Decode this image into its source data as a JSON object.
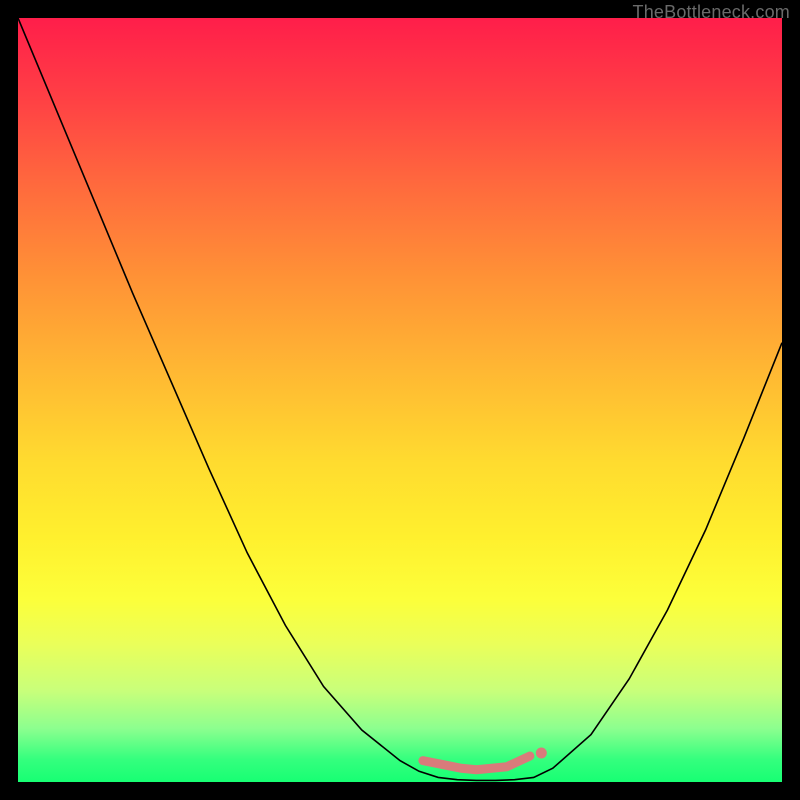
{
  "watermark": "TheBottleneck.com",
  "chart_data": {
    "type": "line",
    "title": "",
    "xlabel": "",
    "ylabel": "",
    "x": [
      0.0,
      0.05,
      0.1,
      0.15,
      0.2,
      0.25,
      0.3,
      0.35,
      0.4,
      0.45,
      0.5,
      0.525,
      0.55,
      0.575,
      0.6,
      0.625,
      0.65,
      0.675,
      0.7,
      0.75,
      0.8,
      0.85,
      0.9,
      0.95,
      1.0
    ],
    "values": [
      1.0,
      0.88,
      0.76,
      0.64,
      0.525,
      0.41,
      0.3,
      0.205,
      0.125,
      0.068,
      0.028,
      0.014,
      0.006,
      0.003,
      0.002,
      0.002,
      0.003,
      0.006,
      0.018,
      0.062,
      0.135,
      0.225,
      0.33,
      0.45,
      0.575
    ],
    "marker_cluster": {
      "x": [
        0.53,
        0.56,
        0.58,
        0.6,
        0.62,
        0.64,
        0.67
      ],
      "values": [
        0.028,
        0.022,
        0.018,
        0.016,
        0.018,
        0.02,
        0.034
      ]
    },
    "xlim": [
      0,
      1
    ],
    "ylim": [
      0,
      1
    ],
    "colors": {
      "curve": "#000000",
      "markers": "#d97b7b",
      "gradient_top": "#ff1e4a",
      "gradient_bottom": "#17ff73"
    }
  }
}
